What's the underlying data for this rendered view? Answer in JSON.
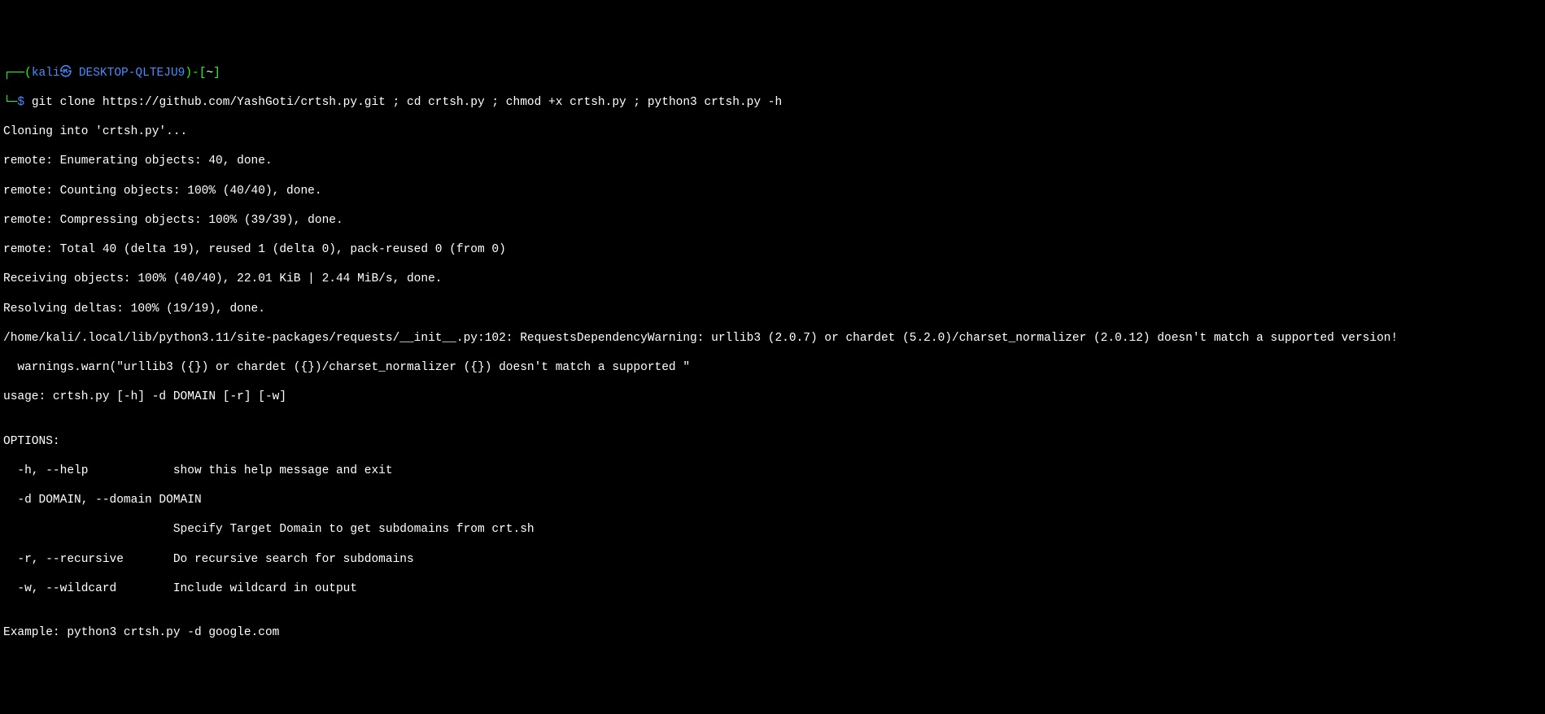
{
  "prompt": {
    "left_corner": "┌──(",
    "user_host": "kali㉿ DESKTOP-QLTEJU9",
    "mid": ")-[",
    "cwd": "~",
    "right_bracket": "]",
    "bottom_corner": "└─",
    "dollar": "$ ",
    "command": "git clone https://github.com/YashGoti/crtsh.py.git ; cd crtsh.py ; chmod +x crtsh.py ; python3 crtsh.py -h"
  },
  "lines": {
    "l01": "Cloning into 'crtsh.py'...",
    "l02": "remote: Enumerating objects: 40, done.",
    "l03": "remote: Counting objects: 100% (40/40), done.",
    "l04": "remote: Compressing objects: 100% (39/39), done.",
    "l05": "remote: Total 40 (delta 19), reused 1 (delta 0), pack-reused 0 (from 0)",
    "l06": "Receiving objects: 100% (40/40), 22.01 KiB | 2.44 MiB/s, done.",
    "l07": "Resolving deltas: 100% (19/19), done.",
    "l08": "/home/kali/.local/lib/python3.11/site-packages/requests/__init__.py:102: RequestsDependencyWarning: urllib3 (2.0.7) or chardet (5.2.0)/charset_normalizer (2.0.12) doesn't match a supported version!",
    "l09": "  warnings.warn(\"urllib3 ({}) or chardet ({})/charset_normalizer ({}) doesn't match a supported \"",
    "l10": "usage: crtsh.py [-h] -d DOMAIN [-r] [-w]",
    "l11": "",
    "l12": "OPTIONS:",
    "l13": "  -h, --help            show this help message and exit",
    "l14": "  -d DOMAIN, --domain DOMAIN",
    "l15": "                        Specify Target Domain to get subdomains from crt.sh",
    "l16": "  -r, --recursive       Do recursive search for subdomains",
    "l17": "  -w, --wildcard        Include wildcard in output",
    "l18": "",
    "l19": "Example: python3 crtsh.py -d google.com"
  }
}
